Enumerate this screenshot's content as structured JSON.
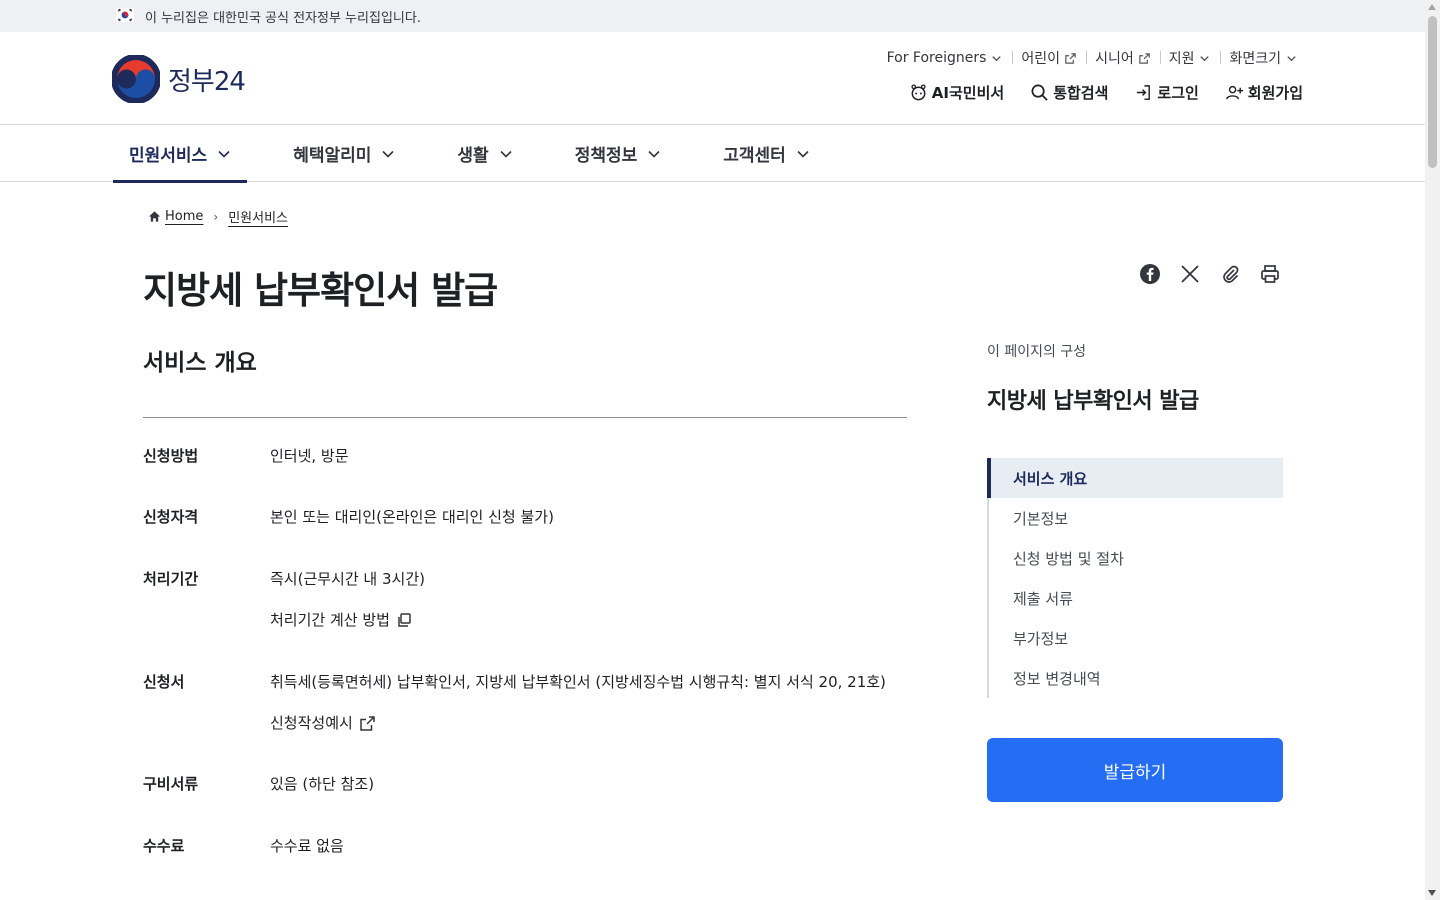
{
  "gov_banner": {
    "text": "이 누리집은 대한민국 공식 전자정부 누리집입니다."
  },
  "logo": {
    "text": "정부24",
    "brand_color": "#1d2a5a",
    "accent_color": "#e63b2e"
  },
  "utility_nav": [
    {
      "label": "For Foreigners",
      "icon": "chevron-down-icon"
    },
    {
      "label": "어린이",
      "icon": "external-link-icon"
    },
    {
      "label": "시니어",
      "icon": "external-link-icon"
    },
    {
      "label": "지원",
      "icon": "chevron-down-icon"
    },
    {
      "label": "화면크기",
      "icon": "chevron-down-icon"
    }
  ],
  "header_actions": [
    {
      "label": "AI국민비서",
      "icon": "ai-assistant-icon"
    },
    {
      "label": "통합검색",
      "icon": "search-icon"
    },
    {
      "label": "로그인",
      "icon": "login-icon"
    },
    {
      "label": "회원가입",
      "icon": "user-add-icon"
    }
  ],
  "gnb": [
    {
      "label": "민원서비스",
      "active": true
    },
    {
      "label": "혜택알리미",
      "active": false
    },
    {
      "label": "생활",
      "active": false
    },
    {
      "label": "정책정보",
      "active": false
    },
    {
      "label": "고객센터",
      "active": false
    }
  ],
  "breadcrumb": {
    "home": "Home",
    "current": "민원서비스"
  },
  "page_title": "지방세 납부확인서 발급",
  "share_icons": [
    "facebook-icon",
    "x-icon",
    "attach-link-icon",
    "print-icon"
  ],
  "section_title": "서비스 개요",
  "info_rows": [
    {
      "label": "신청방법",
      "values": [
        "인터넷, 방문"
      ]
    },
    {
      "label": "신청자격",
      "values": [
        "본인 또는 대리인(온라인은 대리인 신청 불가)"
      ]
    },
    {
      "label": "처리기간",
      "values": [
        "즉시(근무시간 내 3시간)"
      ],
      "link": "처리기간 계산 방법"
    },
    {
      "label": "신청서",
      "values": [
        "취득세(등록면허세) 납부확인서, 지방세 납부확인서 (지방세징수법 시행규칙: 별지 서식 20, 21호)"
      ],
      "link": "신청작성예시"
    },
    {
      "label": "구비서류",
      "values": [
        "있음 (하단 참조)"
      ]
    },
    {
      "label": "수수료",
      "values": [
        "수수료 없음"
      ]
    }
  ],
  "toc": {
    "caption": "이 페이지의 구성",
    "title": "지방세 납부확인서 발급",
    "items": [
      {
        "label": "서비스 개요",
        "active": true
      },
      {
        "label": "기본정보",
        "active": false
      },
      {
        "label": "신청 방법 및 절차",
        "active": false
      },
      {
        "label": "제출 서류",
        "active": false
      },
      {
        "label": "부가정보",
        "active": false
      },
      {
        "label": "정보 변경내역",
        "active": false
      }
    ]
  },
  "primary_button": {
    "label": "발급하기",
    "color": "#256ef4"
  }
}
